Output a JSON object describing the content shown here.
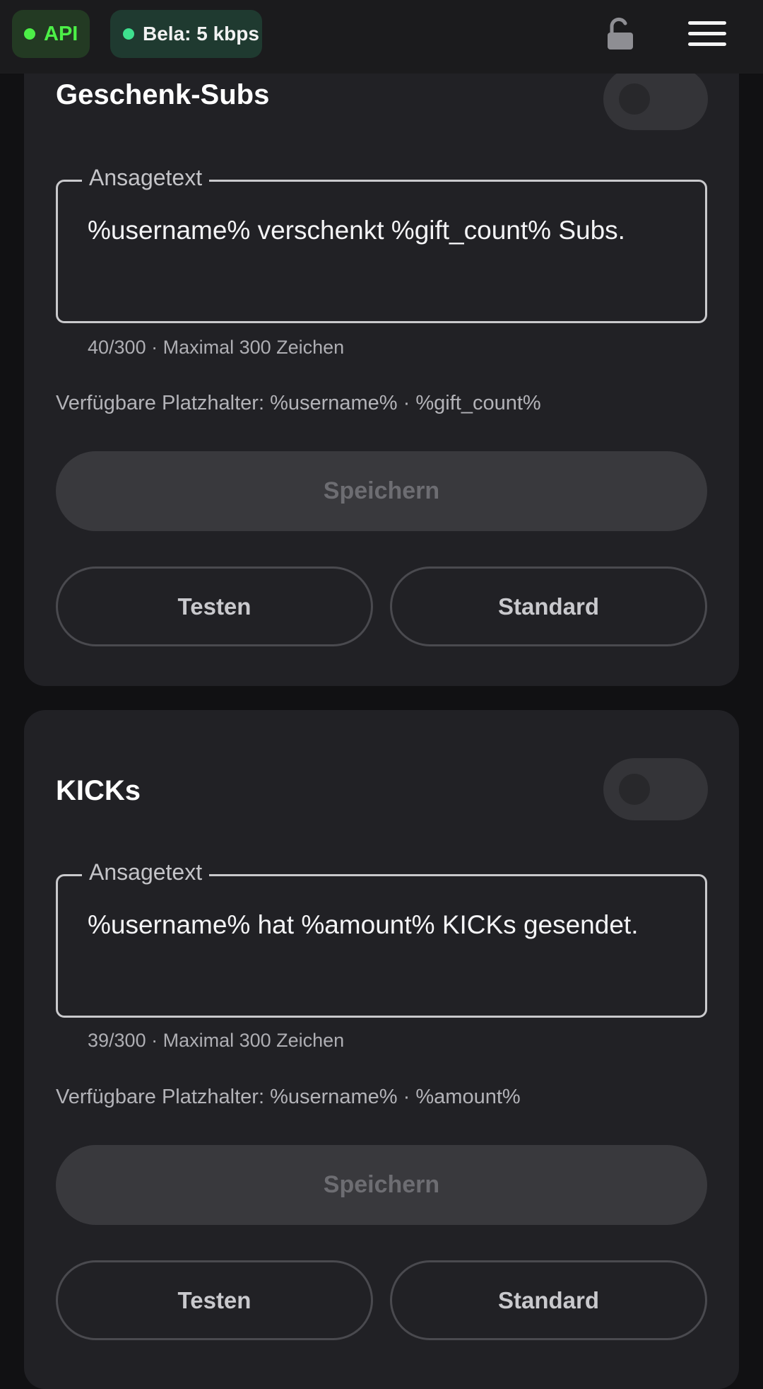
{
  "status_bar": {
    "api_label": "API",
    "bitrate_label": "Bela: 5 kbps",
    "lock_icon": "unlock-icon",
    "menu_icon": "hamburger-menu-icon",
    "api_color": "#4CF047",
    "bitrate_dot_color": "#3EE08E"
  },
  "cards": [
    {
      "title": "Geschenk-Subs",
      "enabled": false,
      "field_label": "Ansagetext",
      "field_value": "%username% verschenkt %gift_count% Subs.",
      "counter": "40/300 · Maximal 300 Zeichen",
      "placeholders": "Verfügbare Platzhalter: %username% · %gift_count%",
      "save_label": "Speichern",
      "test_label": "Testen",
      "default_label": "Standard"
    },
    {
      "title": "KICKs",
      "enabled": false,
      "field_label": "Ansagetext",
      "field_value": "%username% hat %amount% KICKs gesendet.",
      "counter": "39/300 · Maximal 300 Zeichen",
      "placeholders": "Verfügbare Platzhalter: %username% · %amount%",
      "save_label": "Speichern",
      "test_label": "Testen",
      "default_label": "Standard"
    }
  ]
}
